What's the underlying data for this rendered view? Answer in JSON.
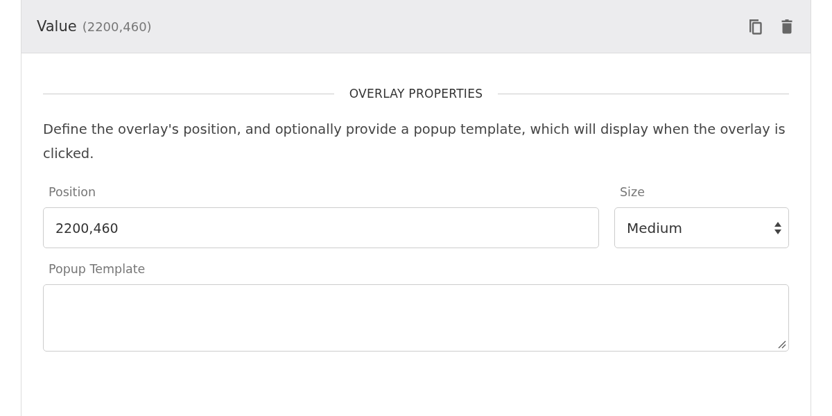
{
  "panel": {
    "title": "Value",
    "subtitle": "(2200,460)"
  },
  "section": {
    "heading": "OVERLAY PROPERTIES",
    "description": "Define the overlay's position, and optionally provide a popup template, which will display when the overlay is clicked."
  },
  "fields": {
    "position": {
      "label": "Position",
      "value": "2200,460"
    },
    "size": {
      "label": "Size",
      "value": "Medium"
    },
    "popup_template": {
      "label": "Popup Template"
    }
  }
}
